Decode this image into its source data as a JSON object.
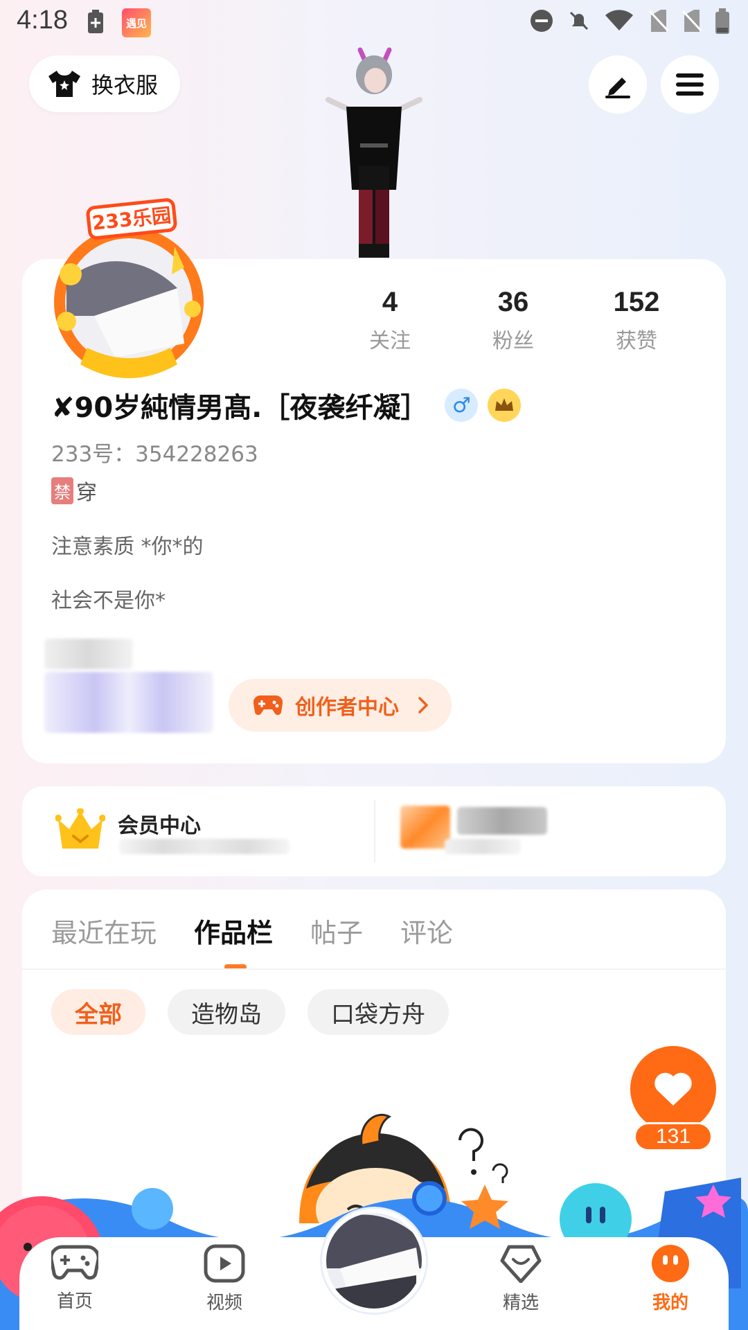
{
  "status_bar": {
    "time": "4:18",
    "app_badge": "遇见"
  },
  "top_bar": {
    "outfit_label": "换衣服"
  },
  "avatar_frame": {
    "badge_text": "233乐园"
  },
  "profile": {
    "stats": [
      {
        "value": "4",
        "label": "关注"
      },
      {
        "value": "36",
        "label": "粉丝"
      },
      {
        "value": "152",
        "label": "获赞"
      }
    ],
    "nickname": "✘90岁純情男髙.［夜袭纤凝］",
    "gender_symbol": "♂",
    "uid": "233号：354228263",
    "tag_chip": "禁",
    "tag_text": "穿",
    "bio_line_1": "注意素质 *你*的",
    "bio_line_2": "社会不是你*",
    "creator_center_label": "创作者中心"
  },
  "member": {
    "title": "会员中心"
  },
  "content": {
    "tabs": [
      "最近在玩",
      "作品栏",
      "帖子",
      "评论"
    ],
    "active_tab": "作品栏",
    "chips": [
      "全部",
      "造物岛",
      "口袋方舟"
    ],
    "active_chip": "全部"
  },
  "like": {
    "count": "131"
  },
  "bottom_nav": {
    "items": [
      {
        "label": "首页",
        "icon": "gamepad-icon"
      },
      {
        "label": "视频",
        "icon": "play-icon"
      },
      {
        "label": "精选",
        "icon": "heart-shield-icon"
      },
      {
        "label": "我的",
        "icon": "smiley-icon"
      }
    ],
    "active": "我的"
  },
  "colors": {
    "accent": "#ff6a14",
    "accent_soft": "#ffece3",
    "card": "#ffffff"
  }
}
